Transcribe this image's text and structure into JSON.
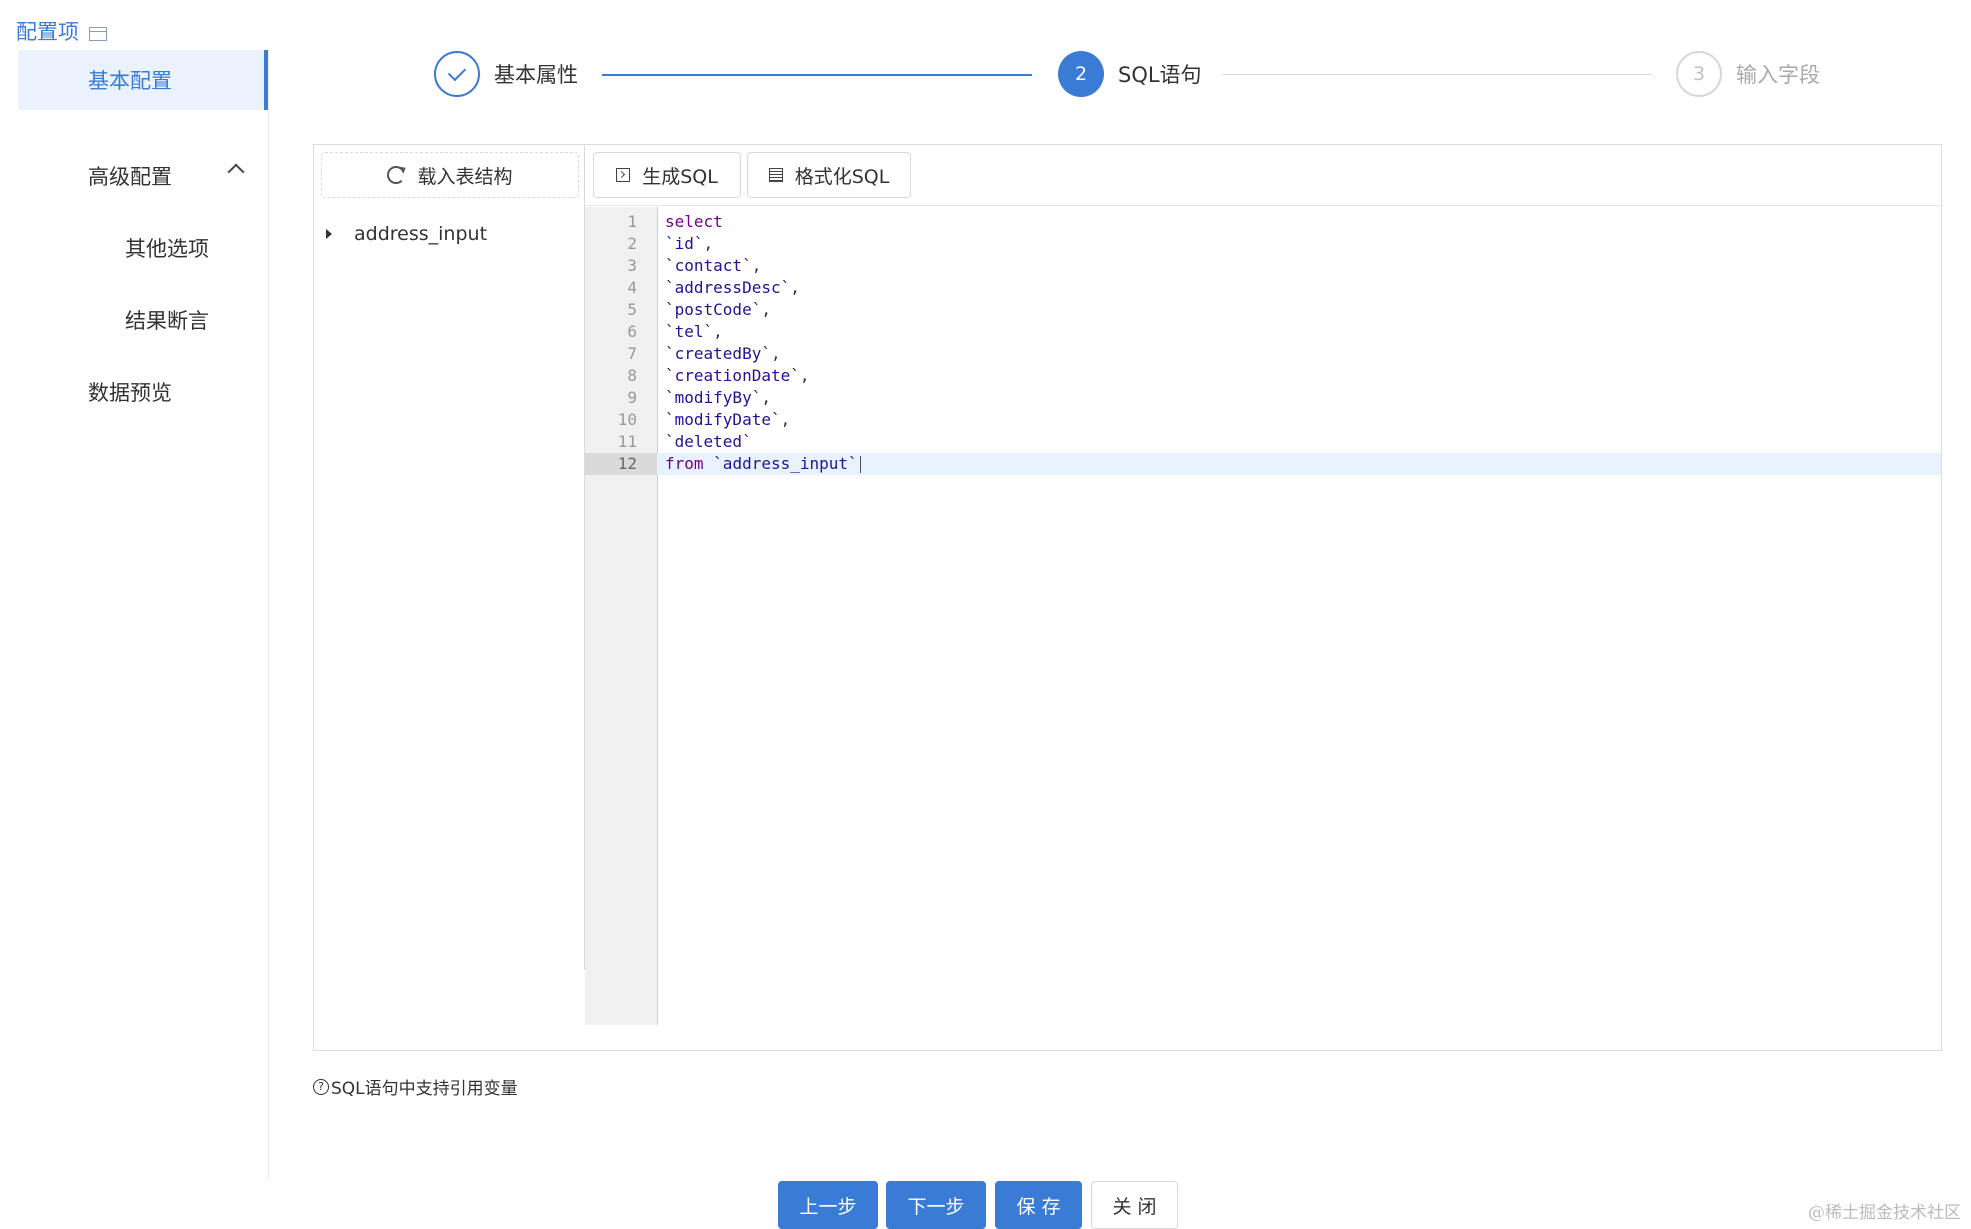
{
  "sidebar": {
    "title": "配置项",
    "items": {
      "basic": "基本配置",
      "advanced": "高级配置",
      "other_options": "其他选项",
      "result_assert": "结果断言",
      "data_preview": "数据预览"
    }
  },
  "steps": [
    {
      "label": "基本属性",
      "status": "done"
    },
    {
      "number": "2",
      "label": "SQL语句",
      "status": "active"
    },
    {
      "number": "3",
      "label": "输入字段",
      "status": "pending"
    }
  ],
  "editor": {
    "load_button": "载入表结构",
    "generate_button": "生成SQL",
    "format_button": "格式化SQL",
    "tree": [
      {
        "label": "address_input"
      }
    ],
    "lines": [
      {
        "n": "1",
        "code": "select"
      },
      {
        "n": "2",
        "code": "`id`,"
      },
      {
        "n": "3",
        "code": "`contact`,"
      },
      {
        "n": "4",
        "code": "`addressDesc`,"
      },
      {
        "n": "5",
        "code": "`postCode`,"
      },
      {
        "n": "6",
        "code": "`tel`,"
      },
      {
        "n": "7",
        "code": "`createdBy`,"
      },
      {
        "n": "8",
        "code": "`creationDate`,"
      },
      {
        "n": "9",
        "code": "`modifyBy`,"
      },
      {
        "n": "10",
        "code": "`modifyDate`,"
      },
      {
        "n": "11",
        "code": "`deleted`"
      },
      {
        "n": "12",
        "code": "from `address_input`"
      }
    ],
    "active_line": 12
  },
  "hint": "SQL语句中支持引用变量",
  "footer": {
    "prev": "上一步",
    "next": "下一步",
    "save": "保 存",
    "close": "关 闭"
  },
  "watermark": "@稀土掘金技术社区",
  "colors": {
    "accent": "#3a7bd5",
    "keyword": "#770088",
    "identifier": "#221199"
  }
}
